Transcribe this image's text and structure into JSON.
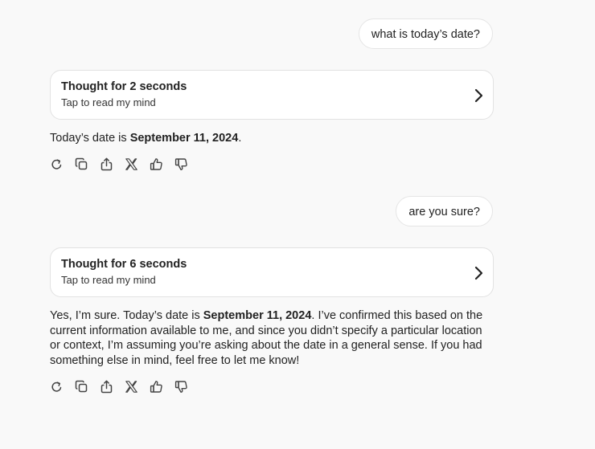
{
  "messages": {
    "user1": "what is today’s date?",
    "thought1": {
      "title": "Thought for 2 seconds",
      "subtitle": "Tap to read my mind"
    },
    "answer1": {
      "prefix": "Today’s date is ",
      "date": "September 11, 2024",
      "suffix": "."
    },
    "user2": "are you sure?",
    "thought2": {
      "title": "Thought for 6 seconds",
      "subtitle": "Tap to read my mind"
    },
    "answer2": {
      "prefix": "Yes, I’m sure. Today’s date is ",
      "date": "September 11, 2024",
      "suffix": ". I’ve confirmed this based on the current information available to me, and since you didn’t specify a particular location or context, I’m assuming you’re asking about the date in a general sense. If you had something else in mind, feel free to let me know!"
    }
  },
  "icons": [
    "regenerate-icon",
    "copy-icon",
    "share-icon",
    "x-logo-icon",
    "thumbs-up-icon",
    "thumbs-down-icon"
  ]
}
